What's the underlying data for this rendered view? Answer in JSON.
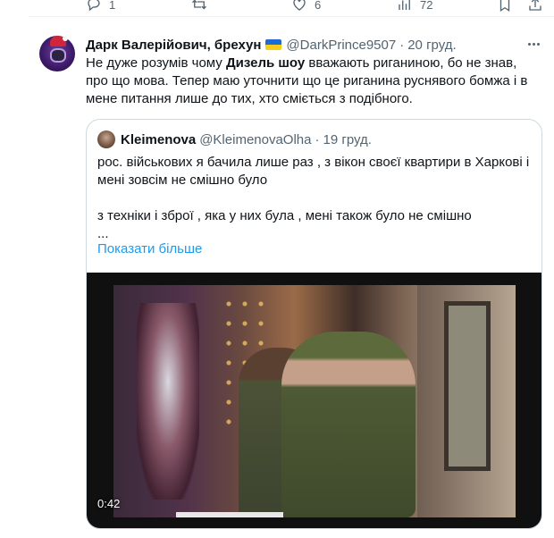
{
  "prev_actions": {
    "reply_count": "1",
    "retweet_count": "",
    "like_count": "6",
    "views_count": "72"
  },
  "tweet": {
    "display_name": "Дарк Валерійович, брехун",
    "handle": "@DarkPrince9507",
    "separator": "·",
    "date": "20 груд.",
    "text_before": "Не дуже розумів чому ",
    "text_bold": "Дизель шоу",
    "text_after": " вважають риганиною, бо не знав, про що мова. Тепер маю уточнити що це риганина руснявого бомжа і в мене питання лише до тих, хто сміється з подібного."
  },
  "quote": {
    "display_name": "Kleimenova",
    "handle": "@KleimenovaOlha",
    "separator": "·",
    "date": "19 груд.",
    "paragraph1": "рос. військових я бачила лише раз , з вікон своєї квартири в Харкові і мені зовсім не смішно було",
    "paragraph2": "з техніки і зброї  , яка у них була , мені також було не смішно",
    "ellipsis": "...",
    "show_more": "Показати більше",
    "video_time": "0:42"
  },
  "colors": {
    "text": "#0f1419",
    "secondary": "#536471",
    "link": "#1d9bf0",
    "border": "#cfd9de"
  }
}
